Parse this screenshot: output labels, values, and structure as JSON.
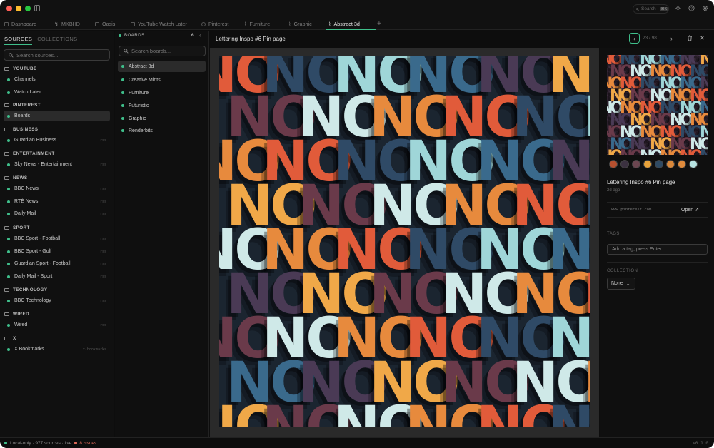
{
  "tabs": [
    {
      "label": "Dashboard"
    },
    {
      "label": "MKBHD"
    },
    {
      "label": "Oasis"
    },
    {
      "label": "YouTube Watch Later"
    },
    {
      "label": "Pinterest"
    },
    {
      "label": "Furniture"
    },
    {
      "label": "Graphic"
    },
    {
      "label": "Abstract 3d",
      "active": true
    }
  ],
  "tab_add": "+",
  "toolbar": {
    "search_label": "Search",
    "search_kbd": "⌘K"
  },
  "sidebar": {
    "tab_sources": "SOURCES",
    "tab_collections": "COLLECTIONS",
    "search_placeholder": "Search sources...",
    "groups": [
      {
        "label": "YOUTUBE",
        "items": [
          {
            "label": "Channels"
          },
          {
            "label": "Watch Later"
          }
        ]
      },
      {
        "label": "PINTEREST",
        "items": [
          {
            "label": "Boards",
            "selected": true
          }
        ]
      },
      {
        "label": "BUSINESS",
        "items": [
          {
            "label": "Guardian Business",
            "badge": "rss"
          }
        ]
      },
      {
        "label": "ENTERTAINMENT",
        "items": [
          {
            "label": "Sky News - Entertainment",
            "badge": "rss"
          }
        ]
      },
      {
        "label": "NEWS",
        "items": [
          {
            "label": "BBC News",
            "badge": "rss"
          },
          {
            "label": "RTÉ News",
            "badge": "rss"
          },
          {
            "label": "Daily Mail",
            "badge": "rss"
          }
        ]
      },
      {
        "label": "SPORT",
        "items": [
          {
            "label": "BBC Sport - Football",
            "badge": "rss"
          },
          {
            "label": "BBC Sport - Golf",
            "badge": "rss"
          },
          {
            "label": "Guardian Sport - Football",
            "badge": "rss"
          },
          {
            "label": "Daily Mail - Sport",
            "badge": "rss"
          }
        ]
      },
      {
        "label": "TECHNOLOGY",
        "items": [
          {
            "label": "BBC Technology",
            "badge": "rss"
          }
        ]
      },
      {
        "label": "WIRED",
        "items": [
          {
            "label": "Wired",
            "badge": "rss"
          }
        ]
      },
      {
        "label": "X",
        "items": [
          {
            "label": "X Bookmarks",
            "badge": "x-bookmarks"
          }
        ]
      }
    ]
  },
  "boards": {
    "header": "BOARDS",
    "count": "6",
    "search_placeholder": "Search boards...",
    "items": [
      {
        "label": "Abstract 3d",
        "selected": true
      },
      {
        "label": "Creative Mints"
      },
      {
        "label": "Furniture"
      },
      {
        "label": "Futuristic"
      },
      {
        "label": "Graphic"
      },
      {
        "label": "Renderbits"
      }
    ]
  },
  "main": {
    "title": "Lettering Inspo #6 Pin page",
    "pager_current": "23",
    "pager_sep": "/",
    "pager_total": "98",
    "image_word": "NO"
  },
  "details": {
    "title": "Lettering Inspo #6 Pin page",
    "time": "2d ago",
    "url": "www.pinterest.com",
    "open_label": "Open",
    "tags_label": "TAGS",
    "tag_placeholder": "Add a tag, press Enter",
    "collection_label": "COLLECTION",
    "collection_value": "None",
    "swatches": [
      "#b6502f",
      "#3b3140",
      "#6b4650",
      "#e8a23a",
      "#2f4a63",
      "#d8873a",
      "#e08b3c",
      "#b8e3e2"
    ]
  },
  "status": {
    "left_text": "Local-only · 977 sources · live",
    "issues": "8 issues",
    "version": "v0.1.0"
  },
  "colors": {
    "accent": "#3fbf8b",
    "error": "#e06a5a",
    "no_palette": [
      "#e15b3a",
      "#f0a848",
      "#2f4a66",
      "#6a3a4a",
      "#9fd6d8",
      "#cfe9e8",
      "#3a6a8c",
      "#e78a3d",
      "#4a3a55"
    ]
  }
}
